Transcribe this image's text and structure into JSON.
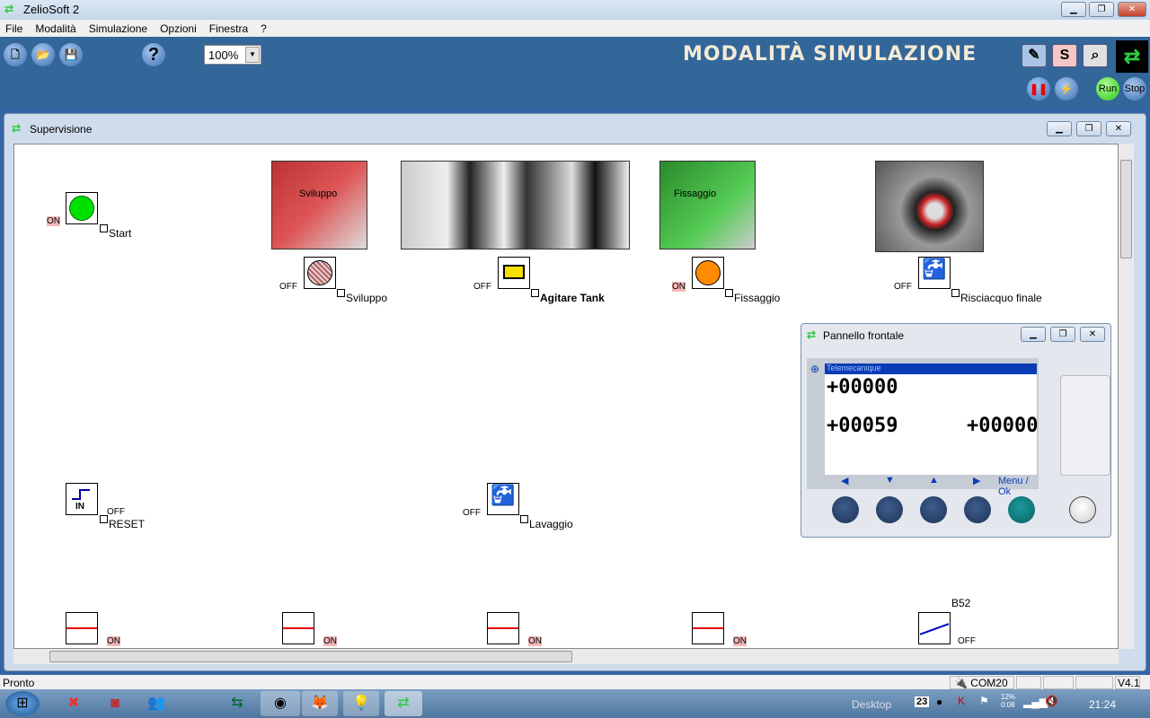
{
  "app": {
    "title": "ZelioSoft 2"
  },
  "menu": [
    "File",
    "Modalità",
    "Simulazione",
    "Opzioni",
    "Finestra",
    "?"
  ],
  "toolbar": {
    "zoom": "100%",
    "mode_title": "MODALITÀ SIMULAZIONE",
    "s_label": "S",
    "run": "Run",
    "stop": "Stop",
    "help": "?"
  },
  "supervision": {
    "title": "Supervisione",
    "blocks": [
      {
        "label": "Start",
        "state": "ON",
        "icon": "green-lamp"
      },
      {
        "label": "Sviluppo",
        "state": "OFF",
        "icon": "lamp-off"
      },
      {
        "label": "Agitare Tank",
        "state": "OFF",
        "icon": "motor"
      },
      {
        "label": "Fissaggio",
        "state": "ON",
        "icon": "orange-lamp"
      },
      {
        "label": "Risciacquo finale",
        "state": "OFF",
        "icon": "tap"
      },
      {
        "label": "RESET",
        "state": "OFF",
        "icon": "digital-input",
        "icon_text": "IN"
      },
      {
        "label": "Lavaggio",
        "state": "OFF",
        "icon": "tap"
      },
      {
        "label": "",
        "state": "ON",
        "icon": "contact-closed"
      },
      {
        "label": "",
        "state": "ON",
        "icon": "contact-closed"
      },
      {
        "label": "",
        "state": "ON",
        "icon": "contact-closed"
      },
      {
        "label": "",
        "state": "ON",
        "icon": "contact-closed"
      },
      {
        "label": "B52",
        "state": "OFF",
        "icon": "contact-open"
      }
    ],
    "photo_texts": [
      "Sviluppo",
      "Fissaggio"
    ]
  },
  "panel": {
    "title": "Pannello frontale",
    "brand": "Telemecanique",
    "line1": "+00000",
    "line2a": "+00059",
    "line2b": "+00000",
    "menu_ok": "Menu / Ok"
  },
  "status": {
    "text": "Pronto",
    "port": "COM20",
    "version": "V4.1"
  },
  "taskbar": {
    "desktop": "Desktop",
    "date": "23",
    "battery": "12%",
    "battery_time": "0:08",
    "clock": "21:24"
  },
  "colors": {
    "toolbar": "#336699",
    "on": "#f4b8b8",
    "lamp_green": "#00e000",
    "lamp_orange": "#ff8c00"
  }
}
